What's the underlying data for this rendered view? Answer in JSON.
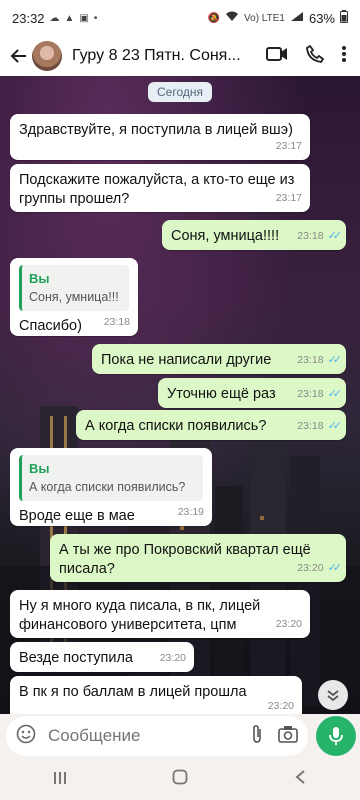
{
  "status": {
    "time": "23:32",
    "network": "Vo) LTE1",
    "battery": "63%"
  },
  "header": {
    "title": "Гуру 8 23 Пятн. Соня..."
  },
  "chat": {
    "date_label": "Сегодня",
    "messages": [
      {
        "text": "Здравствуйте, я поступила в лицей вшэ)",
        "time": "23:17"
      },
      {
        "text": "Подскажите пожалуйста, а кто-то еще из группы прошел?",
        "time": "23:17"
      },
      {
        "text": "Соня, умница!!!!",
        "time": "23:18"
      },
      {
        "quote_author": "Вы",
        "quote_text": "Соня, умница!!!",
        "text": "Спасибо)",
        "time": "23:18"
      },
      {
        "text": "Пока не написали другие",
        "time": "23:18"
      },
      {
        "text": "Уточню ещё раз",
        "time": "23:18"
      },
      {
        "text": "А когда списки появились?",
        "time": "23:18"
      },
      {
        "quote_author": "Вы",
        "quote_text": "А когда списки появились?",
        "text": "Вроде еще в мае",
        "time": "23:19"
      },
      {
        "text": "А ты же про Покровский квартал ещё писала?",
        "time": "23:20"
      },
      {
        "text": "Ну я много куда писала, в пк, лицей финансового университета, цпм",
        "time": "23:20"
      },
      {
        "text": "Везде поступила",
        "time": "23:20"
      },
      {
        "text": "В пк я по баллам в лицей прошла",
        "time": "23:20"
      }
    ]
  },
  "composer": {
    "placeholder": "Сообщение"
  },
  "icons": {
    "back": "arrow-left-icon",
    "video": "video-call-icon",
    "phone": "phone-icon",
    "menu": "more-vert-icon",
    "emoji": "emoji-icon",
    "attach": "attach-icon",
    "camera": "camera-icon",
    "mic": "mic-icon",
    "scroll": "scroll-down-icon"
  },
  "colors": {
    "outgoing_bubble": "#dcf8c6",
    "incoming_bubble": "#ffffff",
    "accent": "#27b36a",
    "read_tick": "#4fb6ec"
  }
}
